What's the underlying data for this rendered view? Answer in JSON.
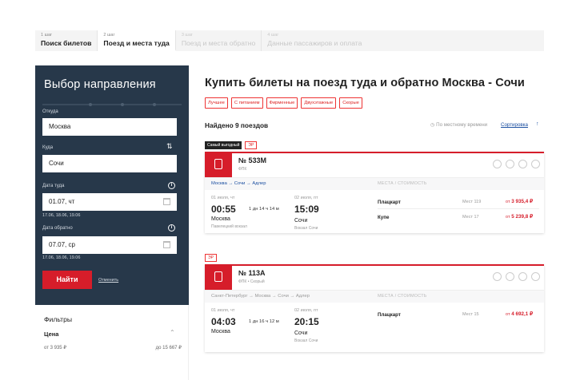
{
  "steps": [
    {
      "num": "1 шаг",
      "title": "Поиск билетов",
      "state": "done"
    },
    {
      "num": "2 шаг",
      "title": "Поезд и места туда",
      "state": "active"
    },
    {
      "num": "3 шаг",
      "title": "Поезд и места обратно",
      "state": "disabled"
    },
    {
      "num": "4 шаг",
      "title": "Данные пассажиров и оплата",
      "state": "disabled"
    }
  ],
  "sidebar": {
    "title": "Выбор направления",
    "from_label": "Откуда",
    "from_value": "Москва",
    "to_label": "Куда",
    "to_value": "Сочи",
    "swap_icon": "swap-icon",
    "depart_label": "Дата туда",
    "depart_value": "01.07, чт",
    "depart_quick": "17.06, 18.06, 19.06",
    "return_label": "Дата обратно",
    "return_value": "07.07, ср",
    "return_quick": "17.06, 18.06, 19.06",
    "find_button": "Найти",
    "cancel_link": "Отменить"
  },
  "filters": {
    "title": "Фильтры",
    "price_label": "Цена",
    "price_from": "от 3 935 ₽",
    "price_to": "до 15 667 ₽"
  },
  "main": {
    "heading": "Купить билеты на поезд туда и обратно Москва - Сочи",
    "chips": [
      "Лучшее",
      "С питанием",
      "Фирменные",
      "Двухэтажные",
      "Скорые"
    ],
    "found": "Найдено 9 поездов",
    "local_time": "По местному времени",
    "sort": "Сортировка",
    "sort_arrow": "↑"
  },
  "trains": [
    {
      "badge": "Самый выгодный",
      "er": "ЭР",
      "number": "№ 533М",
      "category": "ФПК",
      "route_prefix": "",
      "route_from": "Москва",
      "route_to": "Сочи",
      "route_suffix": "→ Адлер",
      "route_text_1": "Москва → Сочи → Адлер",
      "seats_header": "МЕСТА / СТОИМОСТЬ",
      "dep_date": "01 июля, чт",
      "dep_time": "00:55",
      "dep_city": "Москва",
      "dep_station": "Павелецкий вокзал",
      "duration": "1 дн 14 ч 14 м",
      "arr_date": "02 июля, пт",
      "arr_time": "15:09",
      "arr_city": "Сочи",
      "arr_station": "Вокзал Сочи",
      "seats": [
        {
          "type": "Плацкарт",
          "count": "Мест 119",
          "price_prefix": "от",
          "price": "3 935,4 ₽"
        },
        {
          "type": "Купе",
          "count": "Мест 17",
          "price_prefix": "от",
          "price": "5 239,8 ₽"
        }
      ]
    },
    {
      "badge": "",
      "er": "ЭР",
      "number": "№ 113А",
      "category": "ФПК • Скорый",
      "route_text_1": "Санкт-Петербург → Москва → Сочи → Адлер",
      "seats_header": "МЕСТА / СТОИМОСТЬ",
      "dep_date": "01 июля, чт",
      "dep_time": "04:03",
      "dep_city": "Москва",
      "dep_station": "",
      "duration": "1 дн 16 ч 12 м",
      "arr_date": "02 июля, пт",
      "arr_time": "20:15",
      "arr_city": "Сочи",
      "arr_station": "Вокзал Сочи",
      "seats": [
        {
          "type": "Плацкарт",
          "count": "Мест 15",
          "price_prefix": "от",
          "price": "4 692,1 ₽"
        }
      ]
    }
  ],
  "colors": {
    "accent": "#d61d2a",
    "sidebar": "#27384a",
    "link": "#1a4ea0"
  }
}
